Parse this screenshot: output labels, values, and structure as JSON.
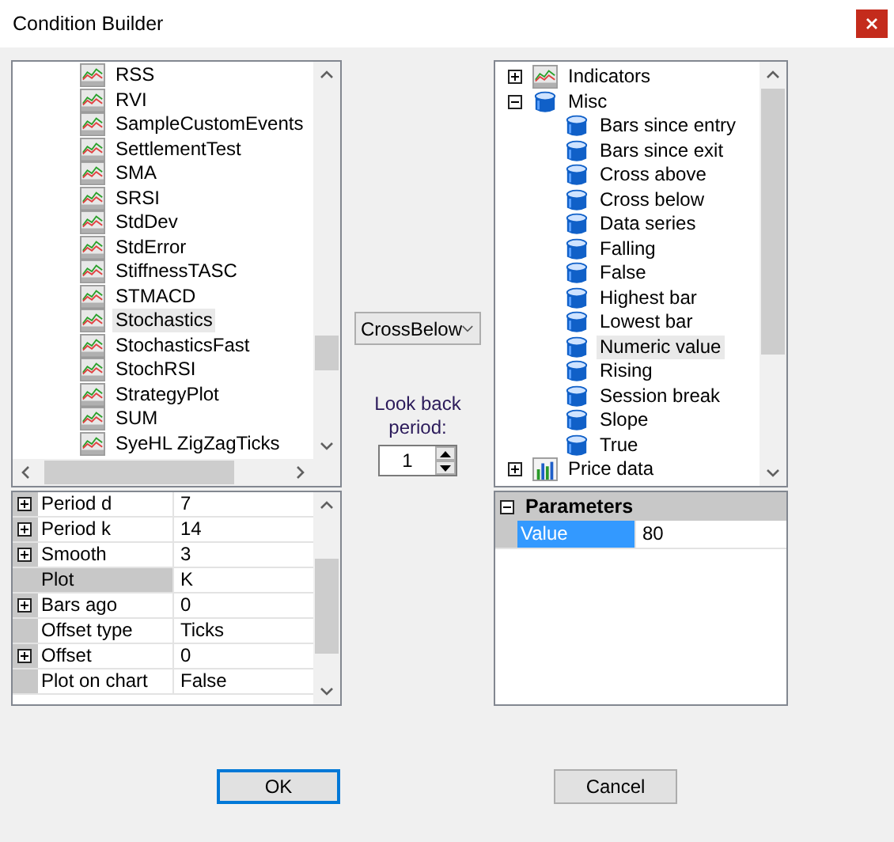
{
  "window": {
    "title": "Condition Builder"
  },
  "indicator_list": [
    {
      "label": "RSS",
      "selected": false
    },
    {
      "label": "RVI",
      "selected": false
    },
    {
      "label": "SampleCustomEvents",
      "selected": false
    },
    {
      "label": "SettlementTest",
      "selected": false
    },
    {
      "label": "SMA",
      "selected": false
    },
    {
      "label": "SRSI",
      "selected": false
    },
    {
      "label": "StdDev",
      "selected": false
    },
    {
      "label": "StdError",
      "selected": false
    },
    {
      "label": "StiffnessTASC",
      "selected": false
    },
    {
      "label": "STMACD",
      "selected": false
    },
    {
      "label": "Stochastics",
      "selected": true
    },
    {
      "label": "StochasticsFast",
      "selected": false
    },
    {
      "label": "StochRSI",
      "selected": false
    },
    {
      "label": "StrategyPlot",
      "selected": false
    },
    {
      "label": "SUM",
      "selected": false
    },
    {
      "label": "SyeHL ZigZagTicks",
      "selected": false
    }
  ],
  "properties": [
    {
      "name": "Period d",
      "value": "7",
      "expandable": true,
      "selected": false
    },
    {
      "name": "Period k",
      "value": "14",
      "expandable": true,
      "selected": false
    },
    {
      "name": "Smooth",
      "value": "3",
      "expandable": true,
      "selected": false
    },
    {
      "name": "Plot",
      "value": "K",
      "expandable": false,
      "selected": true
    },
    {
      "name": "Bars ago",
      "value": "0",
      "expandable": true,
      "selected": false
    },
    {
      "name": "Offset type",
      "value": "Ticks",
      "expandable": false,
      "selected": false
    },
    {
      "name": "Offset",
      "value": "0",
      "expandable": true,
      "selected": false
    },
    {
      "name": "Plot on chart",
      "value": "False",
      "expandable": false,
      "selected": false
    }
  ],
  "operator": {
    "value": "CrossBelow"
  },
  "look_back": {
    "label": "Look back period:",
    "value": "1"
  },
  "tree": [
    {
      "label": "Indicators",
      "kind": "indicator",
      "expanded": false
    },
    {
      "label": "Misc",
      "kind": "misc",
      "expanded": true,
      "children": [
        {
          "label": "Bars since entry",
          "selected": false
        },
        {
          "label": "Bars since exit",
          "selected": false
        },
        {
          "label": "Cross above",
          "selected": false
        },
        {
          "label": "Cross below",
          "selected": false
        },
        {
          "label": "Data series",
          "selected": false
        },
        {
          "label": "Falling",
          "selected": false
        },
        {
          "label": "False",
          "selected": false
        },
        {
          "label": "Highest bar",
          "selected": false
        },
        {
          "label": "Lowest bar",
          "selected": false
        },
        {
          "label": "Numeric value",
          "selected": true
        },
        {
          "label": "Rising",
          "selected": false
        },
        {
          "label": "Session break",
          "selected": false
        },
        {
          "label": "Slope",
          "selected": false
        },
        {
          "label": "True",
          "selected": false
        }
      ]
    },
    {
      "label": "Price data",
      "kind": "price",
      "expanded": false
    }
  ],
  "parameters": {
    "category": "Parameters",
    "expanded": true,
    "rows": [
      {
        "name": "Value",
        "value": "80",
        "selected": true
      }
    ]
  },
  "buttons": [
    {
      "label": "OK",
      "default": true
    },
    {
      "label": "Cancel",
      "default": false
    }
  ]
}
